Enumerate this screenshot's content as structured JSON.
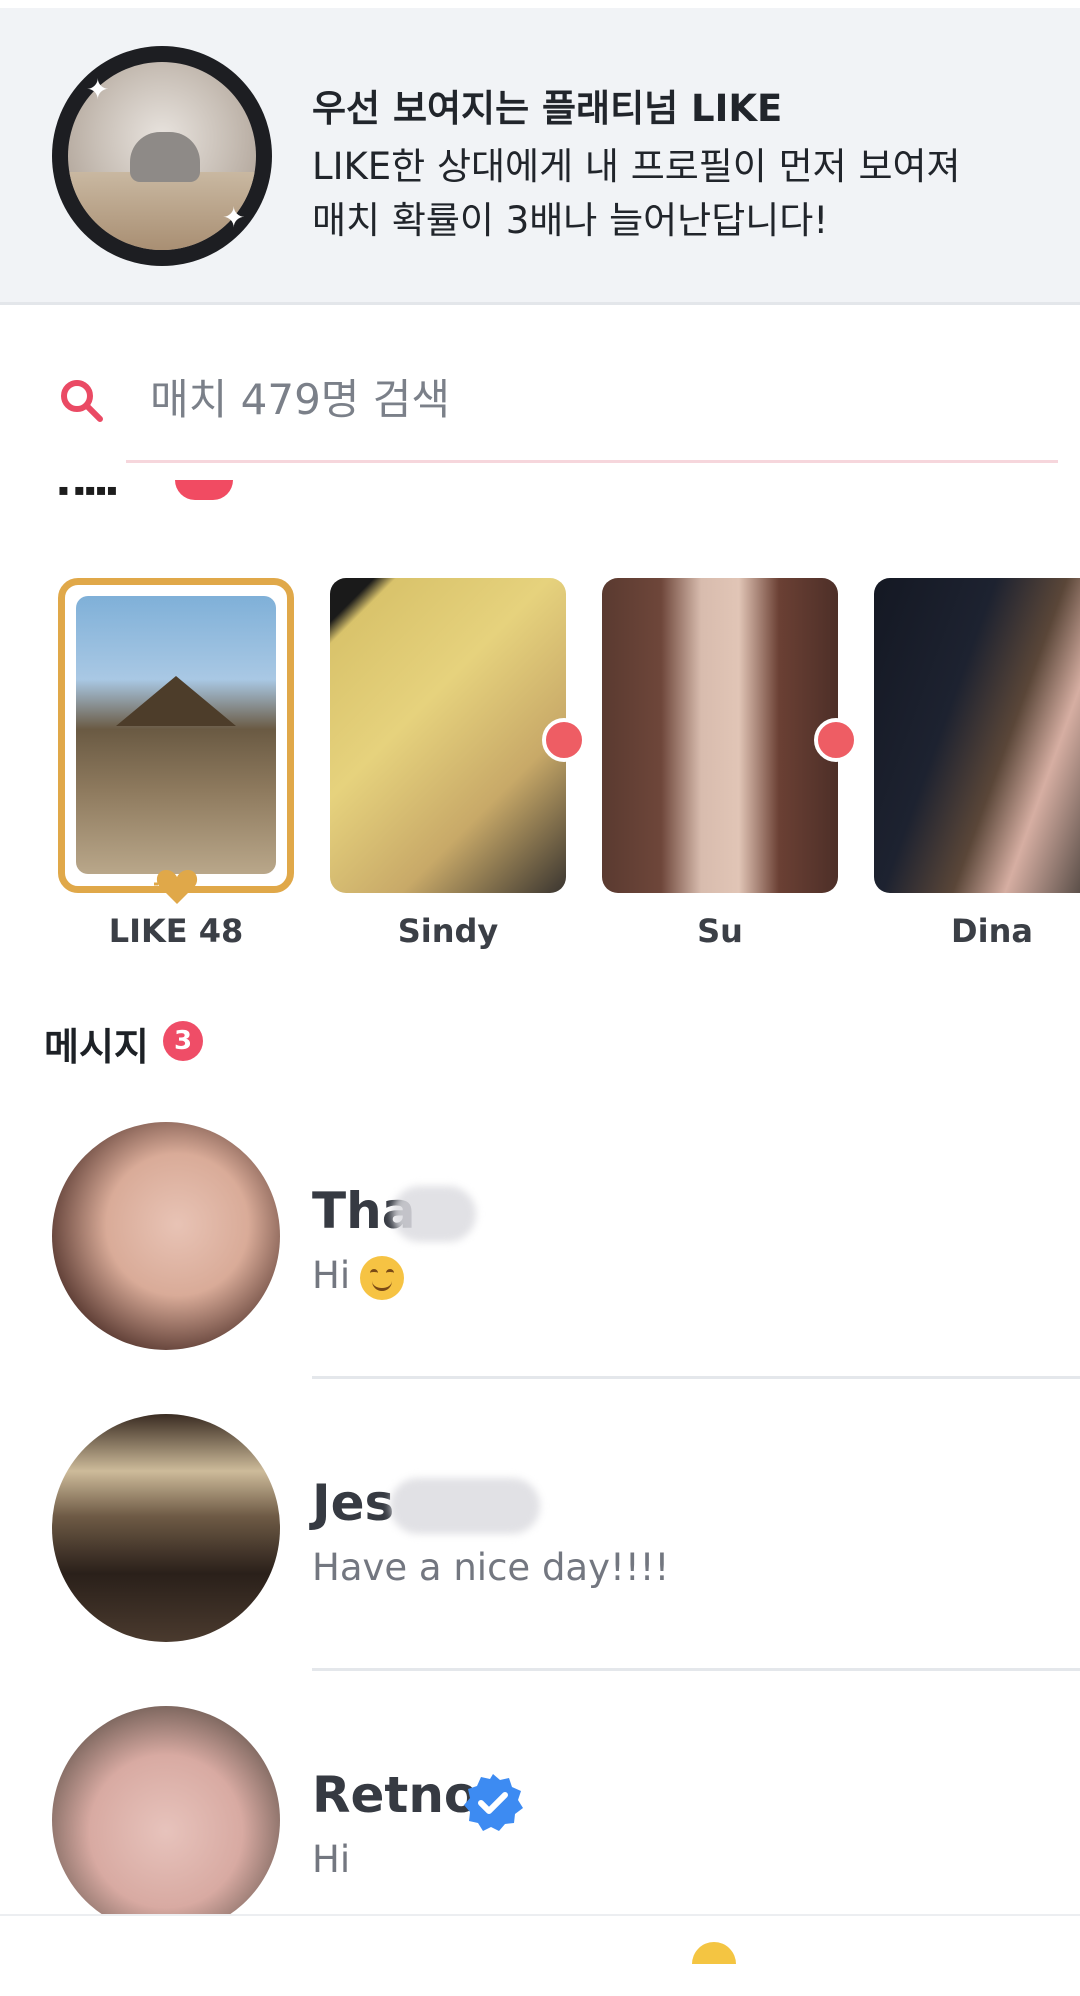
{
  "promo": {
    "title": "우선 보여지는 플래티넘 LIKE",
    "line1": "LIKE한 상대에게 내 프로필이 먼저 보여져",
    "line2": "매치 확률이 3배나 늘어난답니다!"
  },
  "search": {
    "placeholder": "매치 479명 검색",
    "icon": "search-icon"
  },
  "matches": [
    {
      "label": "LIKE 48",
      "type": "likes"
    },
    {
      "label": "Sindy",
      "new": true
    },
    {
      "label": "Su",
      "new": true
    },
    {
      "label": "Dina",
      "new": false
    }
  ],
  "messages_section": {
    "title": "메시지",
    "count": "3"
  },
  "messages": [
    {
      "name": "Tha",
      "preview": "Hi",
      "emoji": "smiling-face"
    },
    {
      "name": "Jes",
      "preview": "Have a nice day!!!!"
    },
    {
      "name": "Retno",
      "preview": "Hi",
      "verified": true
    }
  ],
  "colors": {
    "accent": "#f14b62",
    "gold": "#e0a849",
    "verified": "#3d8bf2",
    "promo_bg": "#f1f3f6"
  }
}
